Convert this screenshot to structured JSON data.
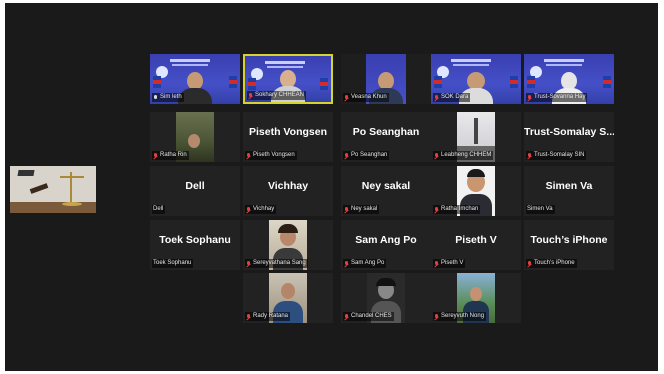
{
  "gallery": {
    "self_view_label": "",
    "row1": [
      {
        "name": "Sim leth",
        "mic": "on"
      },
      {
        "name": "Sokhary CHHEAN",
        "mic": "muted",
        "active": true
      },
      {
        "name": "Veasna Khun",
        "mic": "muted"
      },
      {
        "name": "SOK Dara",
        "mic": "muted"
      },
      {
        "name": "Trust-Sovanna Hay",
        "mic": "muted"
      }
    ],
    "row2": [
      {
        "big": "",
        "name": "Ratha Rin"
      },
      {
        "big": "Piseth Vongsen",
        "name": "Piseth Vongsen"
      },
      {
        "big": "Po Seanghan",
        "name": "Po Seanghan"
      },
      {
        "big": "",
        "name": "Leabheng CHHEM"
      },
      {
        "big": "Trust-Somalay  S...",
        "name": "Trust-Somalay SIN"
      }
    ],
    "row3": [
      {
        "big": "Dell",
        "name": "Dell"
      },
      {
        "big": "Vichhay",
        "name": "Vichhay"
      },
      {
        "big": "Ney sakal",
        "name": "Ney sakal"
      },
      {
        "big": "",
        "name": "Ratha Imchan"
      },
      {
        "big": "Simen Va",
        "name": "Simen Va"
      }
    ],
    "row4": [
      {
        "big": "Toek Sophanu",
        "name": "Toek Sophanu"
      },
      {
        "big": "",
        "name": "Sereyvathana Sang"
      },
      {
        "big": "Sam Ang Po",
        "name": "Sam Ang Po"
      },
      {
        "big": "Piseth V",
        "name": "Piseth V"
      },
      {
        "big": "Touch’s iPhone",
        "name": "Touch’s iPhone"
      }
    ],
    "row5": [
      {
        "big": "",
        "name": "Rady Ratana"
      },
      {
        "big": "",
        "name": "Chandel CHES"
      },
      {
        "big": "",
        "name": "Sereyvuth Nong"
      }
    ]
  },
  "colors": {
    "background": "#1a1a1a",
    "tile": "#222222",
    "active_border": "#d7d32e",
    "muted_mic": "#e04040"
  }
}
